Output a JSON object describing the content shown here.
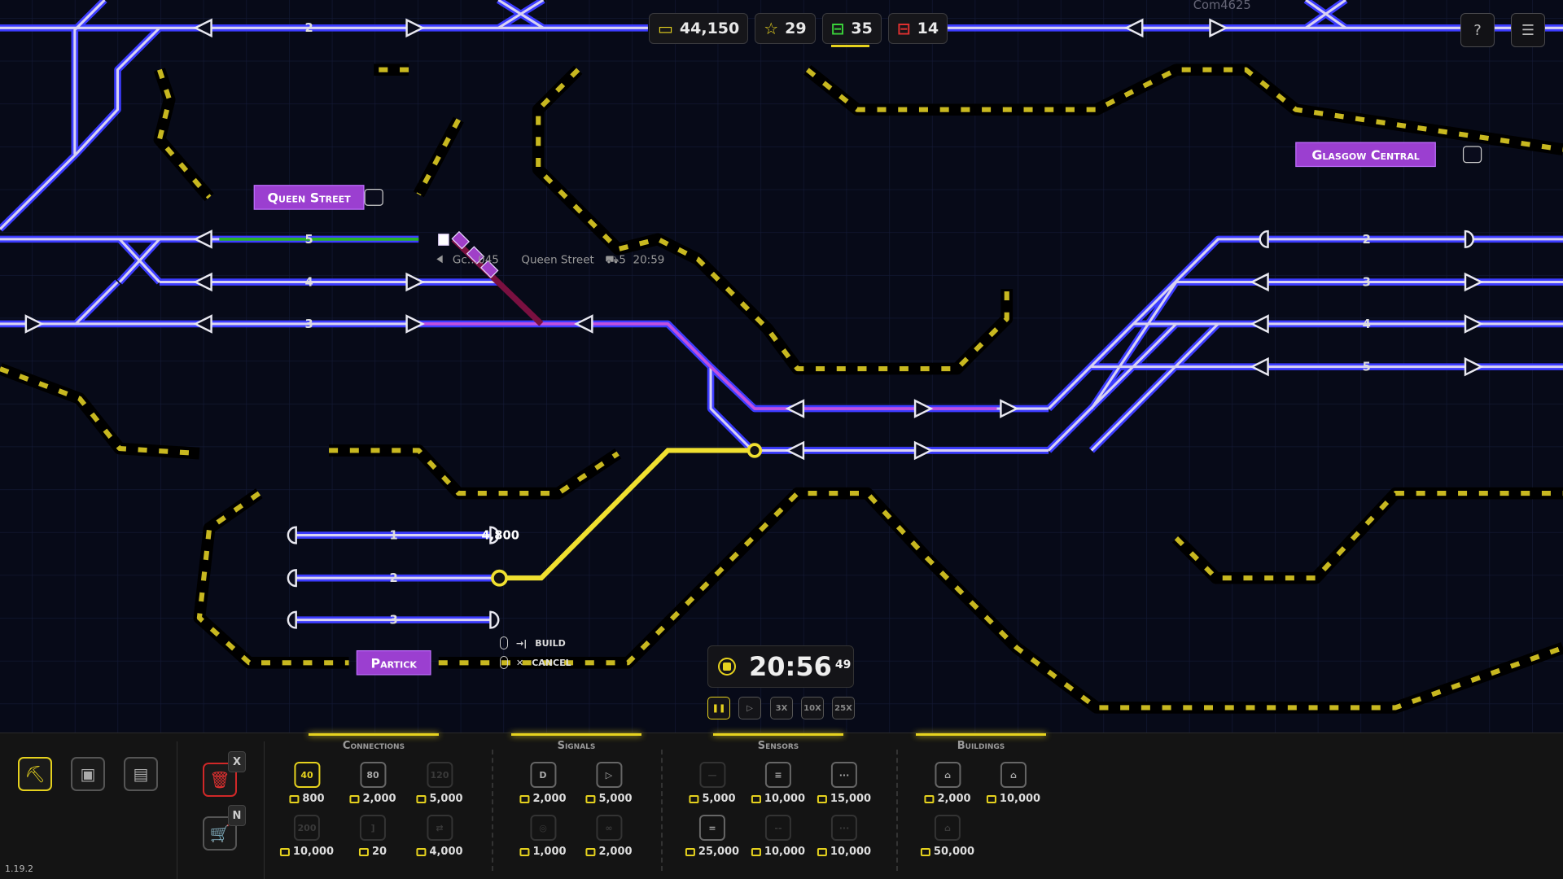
{
  "hud": {
    "money": "44,150",
    "stars": "29",
    "trains_active": "35",
    "trains_waiting": "14"
  },
  "top_right": {
    "help_icon": "?",
    "menu_icon": "☰"
  },
  "map": {
    "stations": {
      "queen_street": "Queen Street",
      "glasgow_central": "Glasgow Central",
      "partick": "Partick"
    },
    "top_track_label": "2",
    "top_right_train": "Com4625",
    "queen_street_platforms": [
      "5",
      "4",
      "3"
    ],
    "glasgow_platforms": [
      "2",
      "3",
      "4",
      "5"
    ],
    "partick_platforms": [
      "1",
      "2",
      "3"
    ],
    "partick_length": "4,800",
    "train_info": {
      "id": "Gc…045",
      "destination": "Queen Street",
      "platform": "5",
      "time": "20:59"
    },
    "hints": {
      "build": "BUILD",
      "cancel": "CANCEL"
    },
    "colors": {
      "track_outer": "#3c3cff",
      "track_inner": "#d8d2f2",
      "selection": "#f0e030",
      "train": "#a040c8",
      "hazard": "#c8b820",
      "station_label": "#9b3fd0"
    }
  },
  "clock": {
    "time": "20:56",
    "seconds": "49",
    "speeds": [
      "",
      "",
      "3X",
      "10X",
      "25X"
    ],
    "selected_speed": "pause"
  },
  "toolbar": {
    "modes": [
      "build",
      "chip",
      "book"
    ],
    "delete_key": "X",
    "shop_key": "N",
    "categories": [
      {
        "name": "Connections",
        "items": [
          {
            "icon": "40",
            "price": "800",
            "state": "selected"
          },
          {
            "icon": "80",
            "price": "2,000"
          },
          {
            "icon": "120",
            "price": "5,000",
            "state": "locked"
          },
          {
            "icon": "200",
            "price": "10,000",
            "state": "locked"
          },
          {
            "icon": "]",
            "price": "20",
            "state": "locked"
          },
          {
            "icon": "⇄",
            "price": "4,000",
            "state": "locked"
          }
        ]
      },
      {
        "name": "Signals",
        "items": [
          {
            "icon": "D",
            "price": "2,000"
          },
          {
            "icon": "▷",
            "price": "5,000"
          },
          {
            "icon": "◎",
            "price": "1,000",
            "state": "locked"
          },
          {
            "icon": "∞",
            "price": "2,000",
            "state": "locked"
          }
        ]
      },
      {
        "name": "Sensors",
        "items": [
          {
            "icon": "—",
            "price": "5,000",
            "state": "locked"
          },
          {
            "icon": "≡",
            "price": "10,000"
          },
          {
            "icon": "···",
            "price": "15,000"
          },
          {
            "icon": "=",
            "price": "25,000"
          },
          {
            "icon": "--",
            "price": "10,000",
            "state": "locked"
          },
          {
            "icon": "···",
            "price": "10,000",
            "state": "locked"
          }
        ]
      },
      {
        "name": "Buildings",
        "items": [
          {
            "icon": "⌂",
            "price": "2,000"
          },
          {
            "icon": "⌂",
            "price": "10,000"
          },
          {
            "icon": "⌂",
            "price": "50,000",
            "state": "locked"
          }
        ]
      }
    ],
    "version": "1.19.2"
  }
}
